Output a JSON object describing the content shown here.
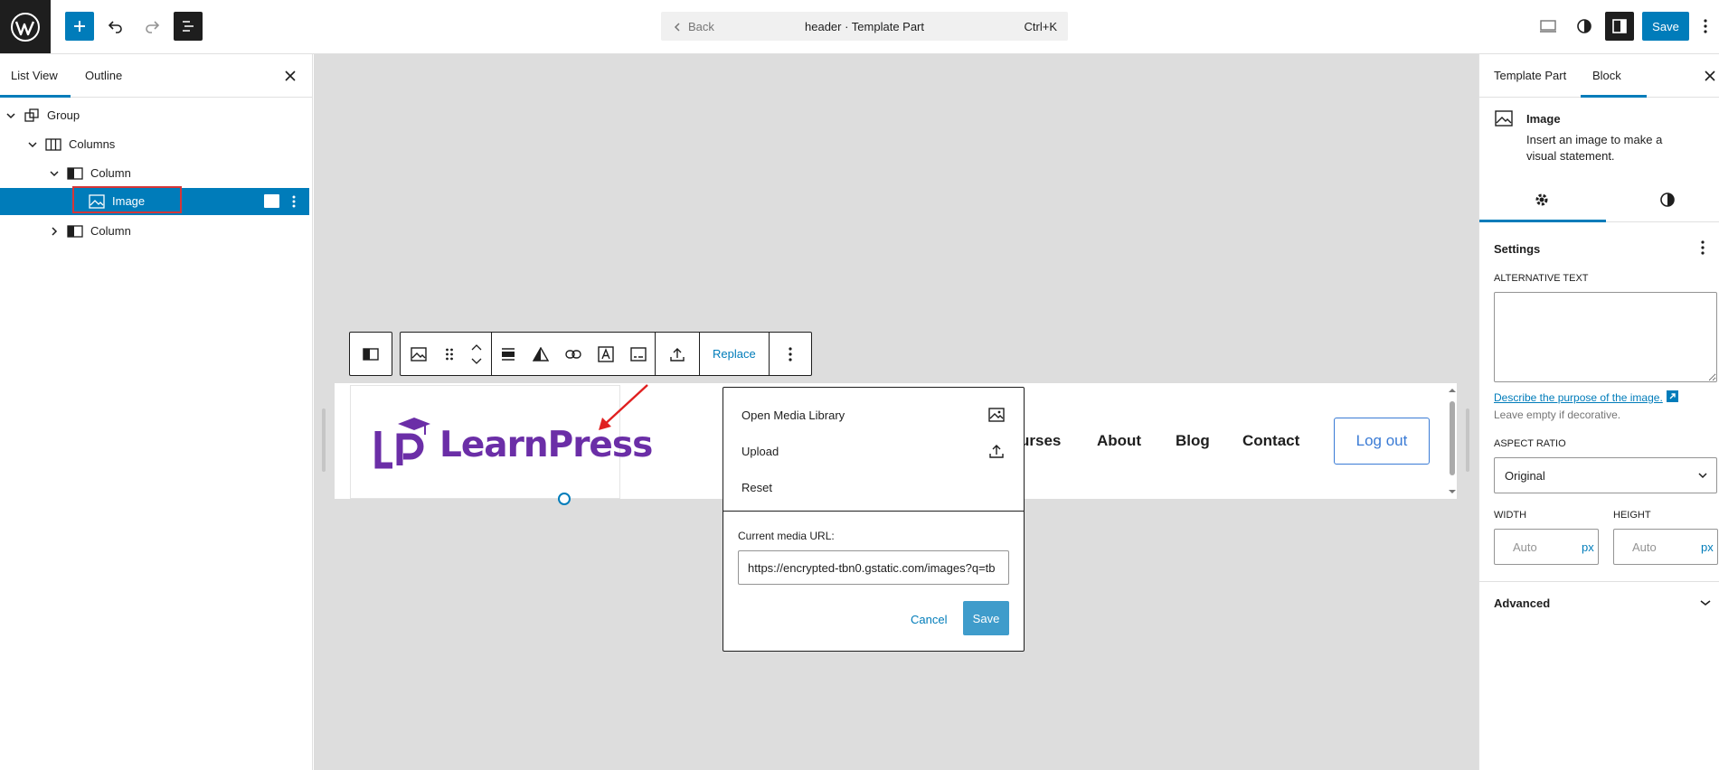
{
  "topbar": {
    "back_label": "Back",
    "document_title": "header · Template Part",
    "shortcut": "Ctrl+K",
    "save_label": "Save",
    "accent_color": "#007cba"
  },
  "left_panel": {
    "tabs": [
      "List View",
      "Outline"
    ],
    "tree": [
      {
        "label": "Group",
        "icon": "group-icon"
      },
      {
        "label": "Columns",
        "icon": "columns-icon"
      },
      {
        "label": "Column",
        "icon": "column-icon"
      },
      {
        "label": "Image",
        "icon": "image-icon",
        "selected": true
      },
      {
        "label": "Column",
        "icon": "column-icon"
      }
    ]
  },
  "block_toolbar": {
    "replace_label": "Replace"
  },
  "header_preview": {
    "logo_text": "LearnPress",
    "nav": [
      "urses",
      "About",
      "Blog",
      "Contact"
    ],
    "logout_label": "Log out",
    "brand_color": "#6b2ea7"
  },
  "media_popover": {
    "items": [
      {
        "label": "Open Media Library",
        "icon": "image-icon"
      },
      {
        "label": "Upload",
        "icon": "upload-icon"
      },
      {
        "label": "Reset",
        "icon": ""
      }
    ],
    "url_label": "Current media URL:",
    "url_value": "https://encrypted-tbn0.gstatic.com/images?q=tb",
    "cancel_label": "Cancel",
    "save_label": "Save"
  },
  "right_panel": {
    "tabs": [
      "Template Part",
      "Block"
    ],
    "block_title": "Image",
    "block_description": "Insert an image to make a visual statement.",
    "settings_title": "Settings",
    "alt_text_label": "ALTERNATIVE TEXT",
    "alt_text_value": "",
    "alt_link": "Describe the purpose of the image.",
    "alt_help": "Leave empty if decorative.",
    "aspect_ratio_label": "ASPECT RATIO",
    "aspect_ratio_value": "Original",
    "width_label": "WIDTH",
    "height_label": "HEIGHT",
    "width_placeholder": "Auto",
    "height_placeholder": "Auto",
    "unit": "px",
    "advanced_label": "Advanced"
  }
}
